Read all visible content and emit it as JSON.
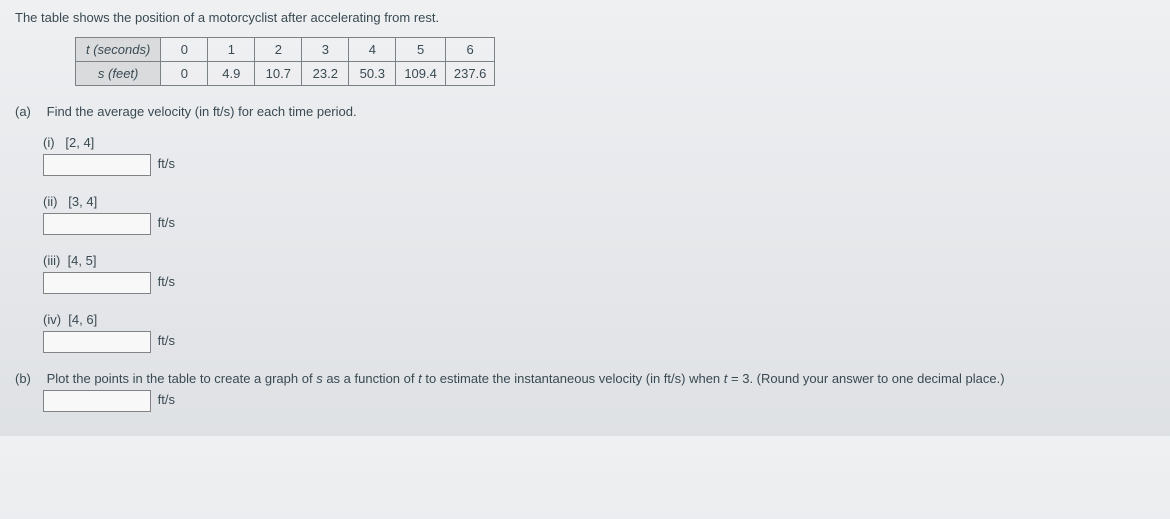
{
  "intro": "The table shows the position of a motorcyclist after accelerating from rest.",
  "table": {
    "row1_head": "t (seconds)",
    "row1": [
      "0",
      "1",
      "2",
      "3",
      "4",
      "5",
      "6"
    ],
    "row2_head": "s (feet)",
    "row2": [
      "0",
      "4.9",
      "10.7",
      "23.2",
      "50.3",
      "109.4",
      "237.6"
    ]
  },
  "part_a": {
    "label": "(a)",
    "text": "Find the average velocity (in ft/s) for each time period.",
    "subs": [
      {
        "roman": "(i)",
        "interval": "[2, 4]",
        "unit": "ft/s"
      },
      {
        "roman": "(ii)",
        "interval": "[3, 4]",
        "unit": "ft/s"
      },
      {
        "roman": "(iii)",
        "interval": "[4, 5]",
        "unit": "ft/s"
      },
      {
        "roman": "(iv)",
        "interval": "[4, 6]",
        "unit": "ft/s"
      }
    ]
  },
  "part_b": {
    "label": "(b)",
    "text_pre": "Plot the points in the table to create a graph of ",
    "s_var": "s",
    "text_mid1": " as a function of ",
    "t_var": "t",
    "text_mid2": " to estimate the instantaneous velocity (in ft/s) when ",
    "t_eq": "t",
    "text_eq": " = 3. (Round your answer to one decimal place.)",
    "unit": "ft/s"
  }
}
